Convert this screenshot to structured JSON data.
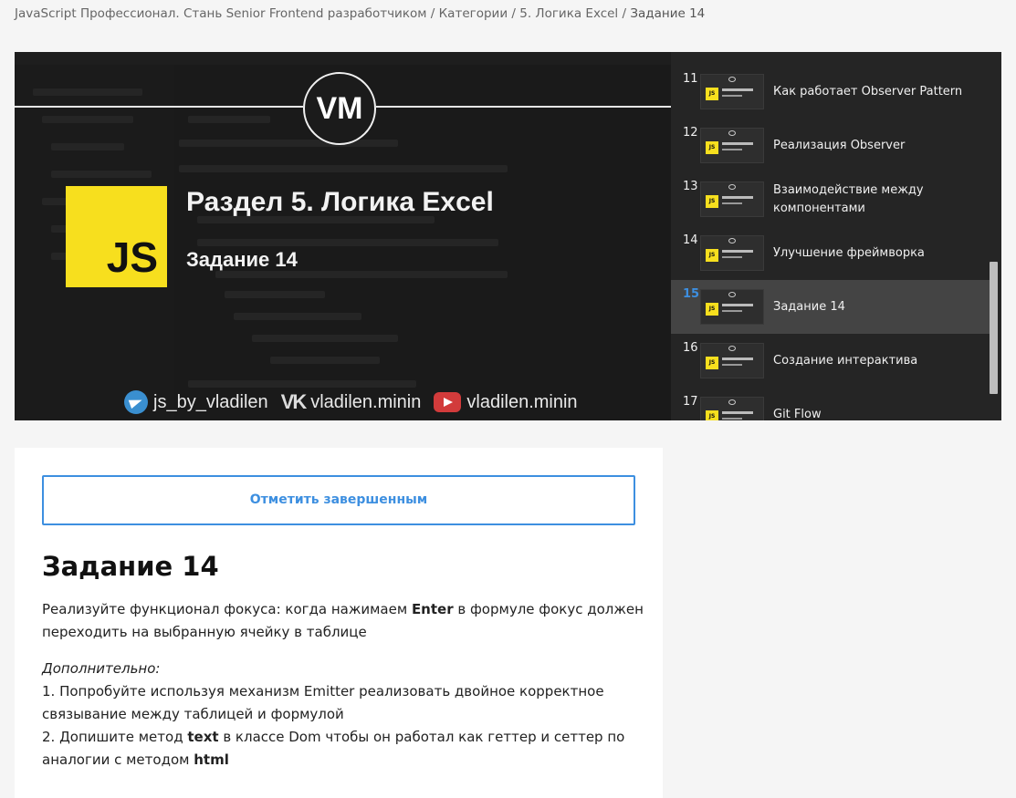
{
  "breadcrumb": {
    "items": [
      "JavaScript Профессионал. Стань Senior Frontend разработчиком",
      "Категории",
      "5. Логика Excel"
    ],
    "separator": "/",
    "current": "Задание 14"
  },
  "video": {
    "logo": "VM",
    "title": "Раздел 5. Логика Excel",
    "subtitle": "Задание 14",
    "badge": "JS",
    "socials": [
      {
        "icon": "telegram-icon",
        "label": "js_by_vladilen"
      },
      {
        "icon": "vk-icon",
        "glyph": "VK",
        "label": "vladilen.minin"
      },
      {
        "icon": "youtube-icon",
        "label": "vladilen.minin"
      }
    ]
  },
  "playlist": {
    "items": [
      {
        "num": "11",
        "title": "Как работает Observer Pattern",
        "active": false
      },
      {
        "num": "12",
        "title": "Реализация Observer",
        "active": false
      },
      {
        "num": "13",
        "title": "Взаимодействие между компонентами",
        "active": false
      },
      {
        "num": "14",
        "title": "Улучшение фреймворка",
        "active": false
      },
      {
        "num": "15",
        "title": "Задание 14",
        "active": true
      },
      {
        "num": "16",
        "title": "Создание интерактива",
        "active": false
      },
      {
        "num": "17",
        "title": "Git Flow",
        "active": false
      }
    ]
  },
  "lesson": {
    "complete_label": "Отметить завершенным",
    "title": "Задание 14",
    "desc_pre": "Реализуйте функционал фокуса: когда нажимаем ",
    "desc_bold": "Enter",
    "desc_post": " в формуле фокус должен переходить на выбранную ячейку в таблице",
    "extra_heading": "Дополнительно:",
    "item1": "1. Попробуйте используя механизм Emitter реализовать двойное корректное связывание между таблицей и формулой",
    "item2_pre": "2. Допишите метод ",
    "item2_b1": "text",
    "item2_mid": " в классе Dom чтобы он работал как геттер и сеттер по аналогии с методом ",
    "item2_b2": "html"
  },
  "colors": {
    "accent": "#3d8fe0",
    "js_yellow": "#f7df1e",
    "player_bg": "#1f1f1f",
    "active_item_bg": "#444444"
  }
}
